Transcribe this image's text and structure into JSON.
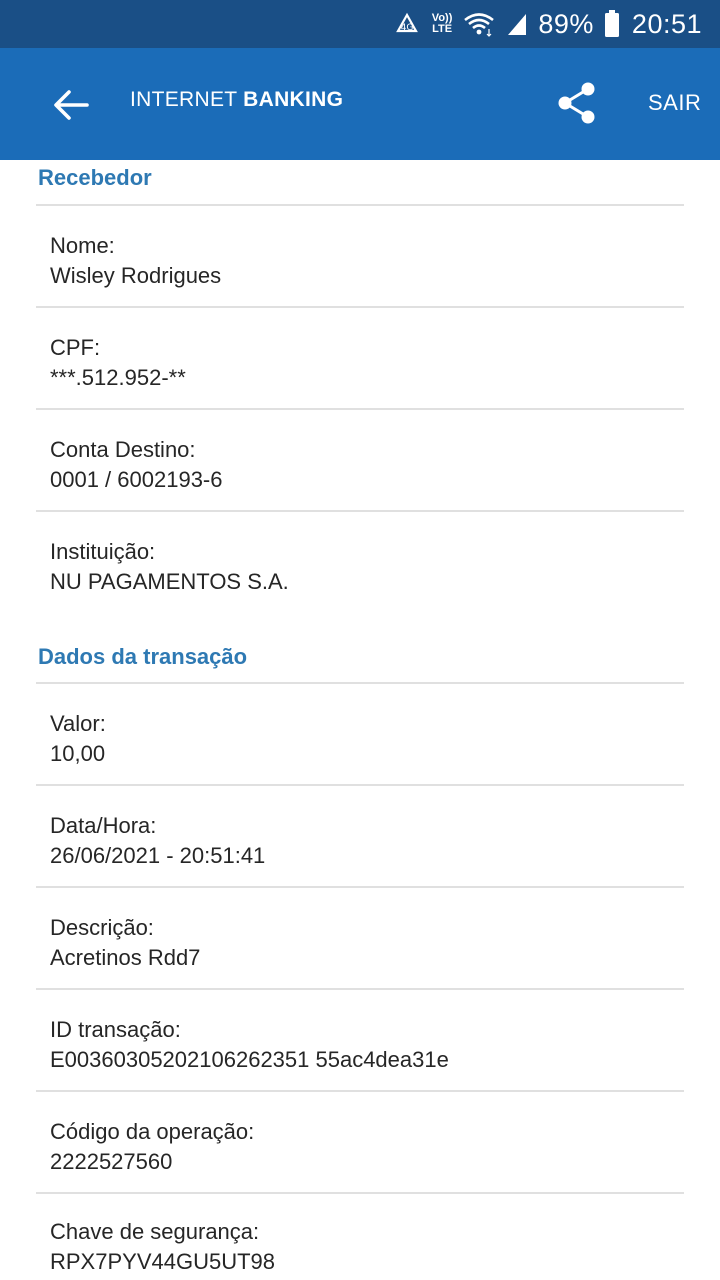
{
  "status_bar": {
    "battery_percent": "89%",
    "time": "20:51",
    "volte_top": "Vo))",
    "volte_bottom": "LTE",
    "icons": [
      "data-saver-icon",
      "volte-icon",
      "wifi-icon",
      "signal-icon",
      "battery-icon"
    ]
  },
  "app_bar": {
    "title_light": "INTERNET ",
    "title_bold": "BANKING",
    "exit_label": "SAIR",
    "back_icon": "arrow-back-icon",
    "share_icon": "share-icon"
  },
  "sections": {
    "recebedor": {
      "heading": "Recebedor",
      "fields": [
        {
          "label": "Nome:",
          "value": "Wisley Rodrigues"
        },
        {
          "label": "CPF:",
          "value": "***.512.952-**"
        },
        {
          "label": "Conta Destino:",
          "value": "0001 / 6002193-6"
        },
        {
          "label": "Instituição:",
          "value": "NU PAGAMENTOS S.A."
        }
      ]
    },
    "transacao": {
      "heading": "Dados da transação",
      "fields": [
        {
          "label": "Valor:",
          "value": "10,00"
        },
        {
          "label": "Data/Hora:",
          "value": "26/06/2021 - 20:51:41"
        },
        {
          "label": "Descrição:",
          "value": "Acretinos Rdd7"
        },
        {
          "label": "ID transação:",
          "value": "E00360305202106262351 55ac4dea31e"
        },
        {
          "label": "Código da operação:",
          "value": "2222527560"
        },
        {
          "label": "Chave de segurança:",
          "value": "RPX7PYV44GU5UT98"
        }
      ]
    }
  },
  "colors": {
    "status_bar": "#1a4f86",
    "app_bar": "#1b6cb8",
    "section_heading": "#2e79b3",
    "divider": "#e0e0e0"
  }
}
